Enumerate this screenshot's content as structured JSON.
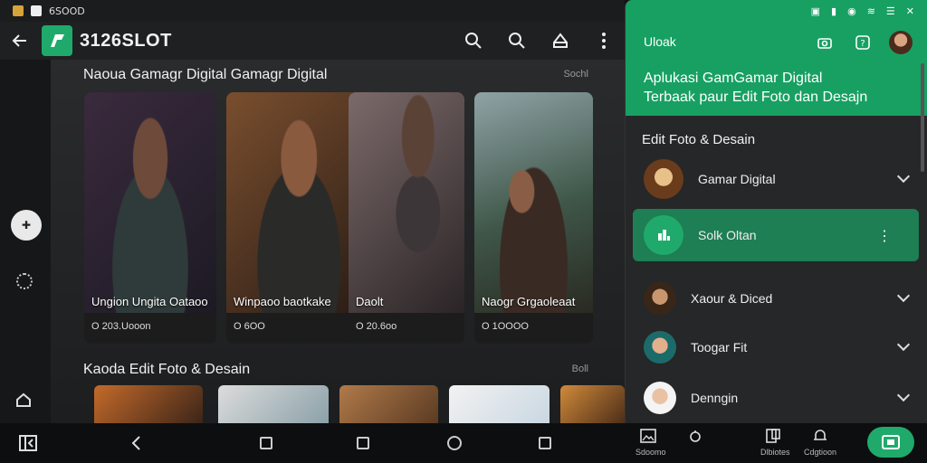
{
  "status": {
    "time": "6SOOD"
  },
  "appbar": {
    "title": "3126SLOT"
  },
  "main": {
    "section1": {
      "title": "Naoua Gamagr Digital Gamagr Digital",
      "more": "Sochl"
    },
    "cards": [
      {
        "caption": "Ungion Ungita Oataoo",
        "meta": "O 203.Uooon"
      },
      {
        "caption": "Winpaoo baotkake",
        "meta": "O 6OO"
      },
      {
        "caption": "Daolt",
        "meta": "O 20.6oo"
      },
      {
        "caption": "Naogr Grgaoleaat",
        "meta": "O 1OOOO"
      }
    ],
    "section2": {
      "title": "Kaoda Edit Foto & Desain",
      "more": "Boll"
    }
  },
  "panel": {
    "header_label": "Uloak",
    "headline_1": "Aplukasi GamGamar Digital",
    "headline_2": "Terbaak paur Edit Foto dan Desajn",
    "subtitle": "Edit Foto & Desain",
    "rows": [
      {
        "name": "Gamar Digital"
      },
      {
        "name": "Solk Oltan"
      },
      {
        "name": "Xaour & Diced"
      },
      {
        "name": "Toogar Fit"
      },
      {
        "name": "Denngin"
      }
    ]
  },
  "nav": {
    "label_1": "Sdoomo",
    "label_2": "Dlbiotes",
    "label_3": "Cdgtioon"
  },
  "colors": {
    "accent": "#17a062",
    "selected": "#1e7e54"
  }
}
